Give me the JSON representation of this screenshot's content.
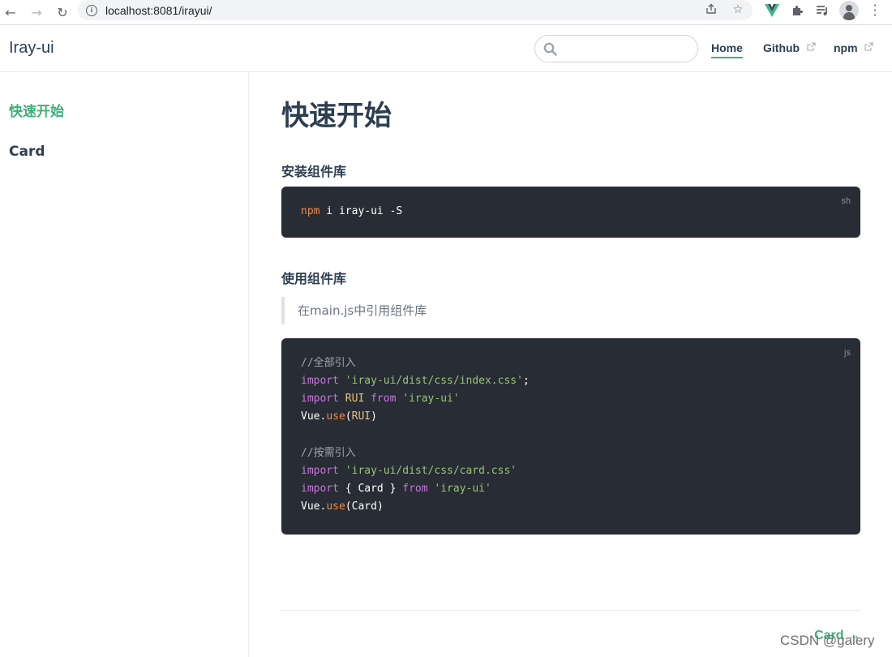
{
  "browser": {
    "url": "localhost:8081/irayui/"
  },
  "navbar": {
    "logo": "Iray-ui",
    "search_placeholder": "",
    "links": [
      {
        "label": "Home",
        "active": true
      },
      {
        "label": "Github",
        "external": true
      },
      {
        "label": "npm",
        "external": true
      }
    ]
  },
  "sidebar": {
    "items": [
      {
        "label": "快速开始",
        "active": true
      },
      {
        "label": "Card",
        "active": false
      }
    ]
  },
  "content": {
    "title": "快速开始",
    "section_install": "安装组件库",
    "install_lang": "sh",
    "install_cmd_prefix": "npm",
    "install_cmd_rest": " i iray-ui -S",
    "section_use": "使用组件库",
    "quote": "在main.js中引用组件库",
    "use_lang": "js",
    "code": {
      "comment_all": "//全部引入",
      "import_kw": "import",
      "from_kw": "from",
      "css_index": "'iray-ui/dist/css/index.css'",
      "semicolon": ";",
      "rui": "RUI",
      "pkg": "'iray-ui'",
      "vue": "Vue",
      "use": "use",
      "comment_partial": "//按需引入",
      "css_card": "'iray-ui/dist/css/card.css'",
      "card_braces": "{ Card }",
      "card": "Card"
    },
    "next_link": "Card →"
  },
  "watermark": "CSDN @galery",
  "colors": {
    "accent": "#3eaf7c",
    "code_bg": "#282c34",
    "text": "#2c3e50"
  }
}
